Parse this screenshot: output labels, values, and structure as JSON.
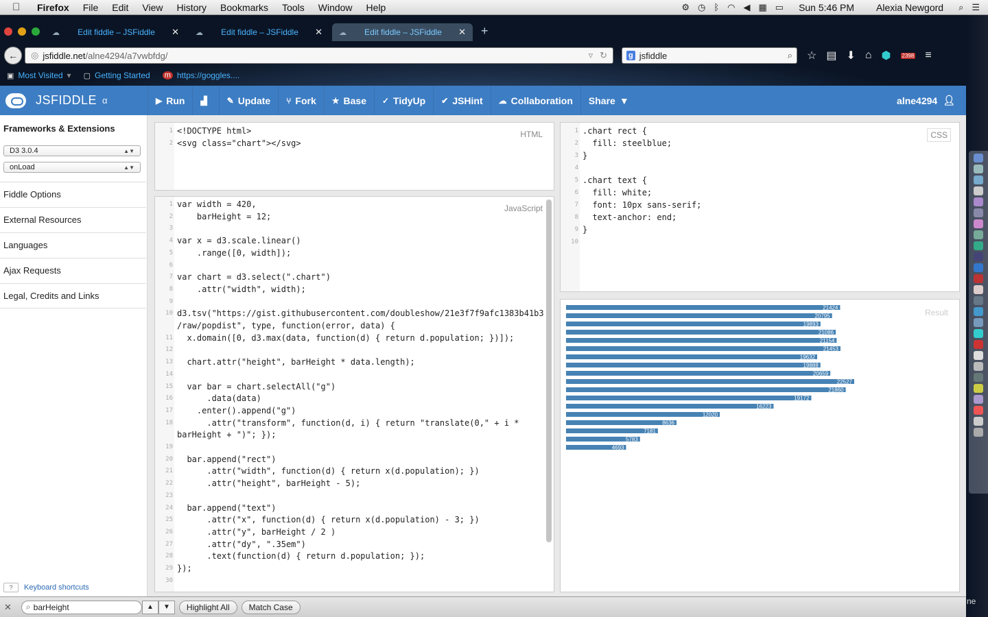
{
  "menubar": {
    "app": "Firefox",
    "items": [
      "File",
      "Edit",
      "View",
      "History",
      "Bookmarks",
      "Tools",
      "Window",
      "Help"
    ],
    "clock": "Sun 5:46 PM",
    "user": "Alexia Newgord"
  },
  "tabs": [
    {
      "title": "Edit fiddle – JSFiddle"
    },
    {
      "title": "Edit fiddle – JSFiddle"
    },
    {
      "title": "Edit fiddle – JSFiddle"
    }
  ],
  "nav": {
    "url_host": "jsfiddle.net",
    "url_path": "/alne4294/a7vwbfdg/",
    "search_value": "jsfiddle",
    "badge": "2398"
  },
  "bookmarks": [
    "Most Visited",
    "Getting Started",
    "https://goggles...."
  ],
  "jsfiddle": {
    "brand": "JSFIDDLE",
    "alpha": "α",
    "actions": [
      "Run",
      "",
      "Update",
      "Fork",
      "Base",
      "TidyUp",
      "JSHint",
      "Collaboration",
      "Share"
    ],
    "user": "alne4294"
  },
  "sidebar": {
    "title": "Frameworks & Extensions",
    "framework": "D3 3.0.4",
    "load": "onLoad",
    "links": [
      "Fiddle Options",
      "External Resources",
      "Languages",
      "Ajax Requests",
      "Legal, Credits and Links"
    ],
    "shortcuts_key": "?",
    "shortcuts": "Keyboard shortcuts"
  },
  "panels": {
    "html_label": "HTML",
    "css_label": "CSS",
    "js_label": "JavaScript",
    "result_label": "Result"
  },
  "html_code": [
    "<!DOCTYPE html>",
    "<svg class=\"chart\"></svg>"
  ],
  "css_code": [
    ".chart rect {",
    "  fill: steelblue;",
    "}",
    "",
    ".chart text {",
    "  fill: white;",
    "  font: 10px sans-serif;",
    "  text-anchor: end;",
    "}",
    ""
  ],
  "js_code": [
    "var width = 420,",
    "    barHeight = 12;",
    "",
    "var x = d3.scale.linear()",
    "    .range([0, width]);",
    "",
    "var chart = d3.select(\".chart\")",
    "    .attr(\"width\", width);",
    "",
    "d3.tsv(\"https://gist.githubusercontent.com/doubleshow/21e3f7f9afc1383b41b3",
    "/raw/popdist\", type, function(error, data) {",
    "  x.domain([0, d3.max(data, function(d) { return d.population; })]);",
    "",
    "  chart.attr(\"height\", barHeight * data.length);",
    "",
    "  var bar = chart.selectAll(\"g\")",
    "      .data(data)",
    "    .enter().append(\"g\")",
    "      .attr(\"transform\", function(d, i) { return \"translate(0,\" + i *",
    "barHeight + \")\"; });",
    "",
    "  bar.append(\"rect\")",
    "      .attr(\"width\", function(d) { return x(d.population); })",
    "      .attr(\"height\", barHeight - 5);",
    "",
    "  bar.append(\"text\")",
    "      .attr(\"x\", function(d) { return x(d.population) - 3; })",
    "      .attr(\"y\", barHeight / 2 )",
    "      .attr(\"dy\", \".35em\")",
    "      .text(function(d) { return d.population; });",
    "});",
    ""
  ],
  "js_line_numbers": [
    "1",
    "2",
    "3",
    "4",
    "5",
    "6",
    "7",
    "8",
    "9",
    "10",
    "",
    "11",
    "12",
    "13",
    "14",
    "15",
    "16",
    "17",
    "18",
    "",
    "19",
    "20",
    "21",
    "22",
    "23",
    "24",
    "25",
    "26",
    "27",
    "28",
    "29",
    "30"
  ],
  "chart_data": {
    "type": "bar",
    "orientation": "horizontal",
    "values": [
      21424,
      20795,
      19893,
      21086,
      21154,
      21453,
      19632,
      19888,
      20659,
      22527,
      21860,
      19172,
      16223,
      12020,
      8636,
      7181,
      5783,
      4693
    ],
    "xlim": [
      0,
      22527
    ],
    "bar_color": "#4682b4",
    "label_color": "#ffffff"
  },
  "findbar": {
    "query": "barHeight",
    "highlight_all": "Highlight All",
    "match_case": "Match Case"
  }
}
